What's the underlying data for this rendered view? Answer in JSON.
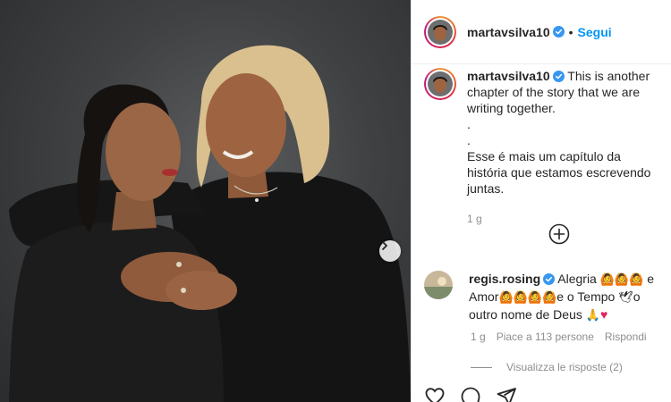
{
  "post": {
    "username": "martavsilva10",
    "dot": "•",
    "follow_label": "Segui",
    "caption": {
      "username": "martavsilva10",
      "line1": "This is another chapter of the story that we are writing together.",
      "dot1": ".",
      "dot2": ".",
      "line2": "Esse é mais um capítulo da história que estamos escrevendo juntas.",
      "time": "1 g"
    }
  },
  "comment": {
    "username": "regis.rosing",
    "text_part1": "Alegria",
    "emoji_group1": "🙆🙆🙆",
    "text_part2": "e Amor",
    "emoji_group2": "🙆🙆🙆🙆",
    "text_part3": "e o Tempo",
    "emoji_prefix": "🕊",
    "text_part4": "o outro nome de Deus",
    "emoji_end": "🙏",
    "heart": "♥",
    "time": "1 g",
    "likes": "Piace a 113 persone",
    "reply_label": "Rispondi",
    "view_replies": "Visualizza le risposte (2)"
  },
  "icons": {
    "verified": "verified-badge-icon",
    "next": "chevron-right-icon",
    "plus": "plus-circle-icon",
    "like": "heart-icon",
    "comment": "comment-icon",
    "share": "paper-plane-icon"
  },
  "colors": {
    "accent": "#0095f6",
    "text": "#262626",
    "muted": "#8e8e8e",
    "photo_bg": "#3f4143"
  }
}
